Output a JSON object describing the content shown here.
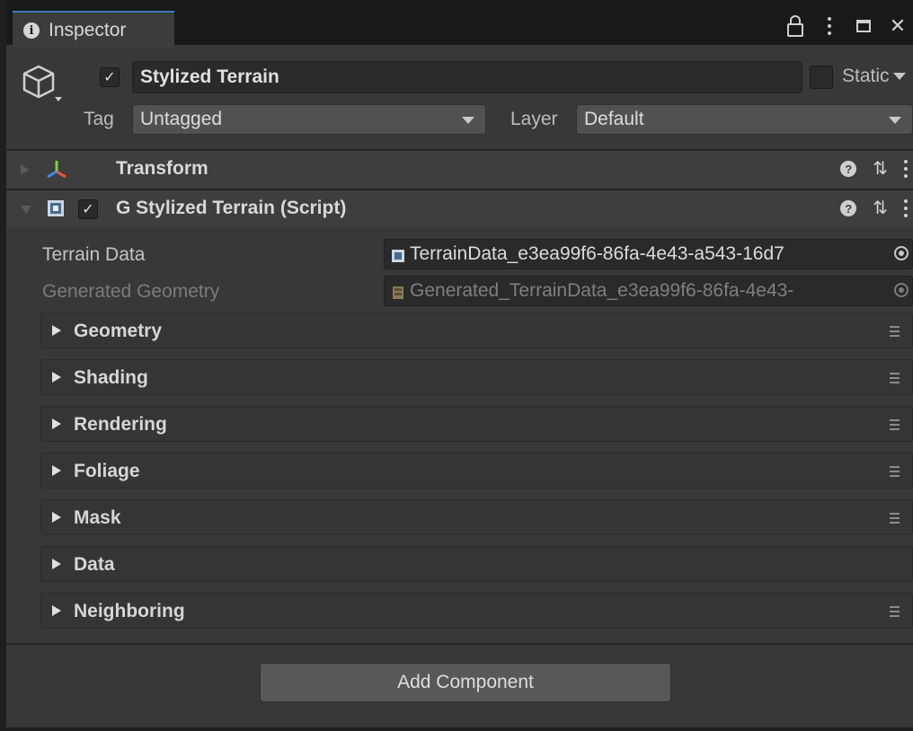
{
  "window": {
    "tab_label": "Inspector",
    "tab_icon": "info-icon",
    "tools": [
      "lock-icon",
      "more-icon",
      "maximize-icon",
      "close-icon"
    ]
  },
  "object": {
    "icon": "gameobject-cube-icon",
    "active": true,
    "name": "Stylized Terrain",
    "static_label": "Static",
    "static": false,
    "tag_label": "Tag",
    "tag_value": "Untagged",
    "layer_label": "Layer",
    "layer_value": "Default"
  },
  "components": [
    {
      "title": "Transform",
      "expanded": false,
      "icon": "transform-axes-icon"
    },
    {
      "title": "G Stylized Terrain (Script)",
      "expanded": true,
      "enabled": true,
      "icon": "script-icon"
    }
  ],
  "properties": {
    "terrain_data_label": "Terrain Data",
    "terrain_data_value": "TerrainData_e3ea99f6-86fa-4e43-a543-16d7",
    "generated_geometry_label": "Generated Geometry",
    "generated_geometry_value": "Generated_TerrainData_e3ea99f6-86fa-4e43-"
  },
  "sections": [
    {
      "label": "Geometry",
      "menu": true
    },
    {
      "label": "Shading",
      "menu": true
    },
    {
      "label": "Rendering",
      "menu": true
    },
    {
      "label": "Foliage",
      "menu": true
    },
    {
      "label": "Mask",
      "menu": true
    },
    {
      "label": "Data",
      "menu": false
    },
    {
      "label": "Neighboring",
      "menu": true
    }
  ],
  "add_component_label": "Add Component",
  "colors": {
    "panel_bg": "#383838",
    "tab_accent": "#3a79bb",
    "header_bg": "#3e3e3e",
    "field_bg": "#2a2a2a"
  }
}
